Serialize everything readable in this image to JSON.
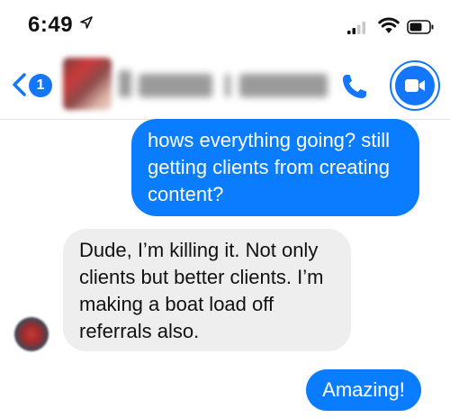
{
  "status_bar": {
    "time": "6:49",
    "icons": [
      "location-arrow-icon",
      "cellular-signal-icon",
      "wifi-icon",
      "battery-icon"
    ]
  },
  "header": {
    "back_badge_count": "1",
    "contact_name": "",
    "icons": [
      "back-chevron-icon",
      "phone-icon",
      "video-camera-icon"
    ]
  },
  "colors": {
    "accent": "#0a7cff",
    "incoming_bubble": "#eeeeef",
    "badge": "#1476fb"
  },
  "messages": [
    {
      "direction": "outgoing",
      "lines": [
        "hows everything going? still",
        "getting clients from creating",
        "content?"
      ]
    },
    {
      "direction": "incoming",
      "lines": [
        "Dude, I’m killing it. Not only",
        "clients but better clients. I’m",
        "making a boat load off",
        "referrals also."
      ]
    },
    {
      "direction": "outgoing",
      "lines": [
        "Amazing!"
      ]
    }
  ]
}
